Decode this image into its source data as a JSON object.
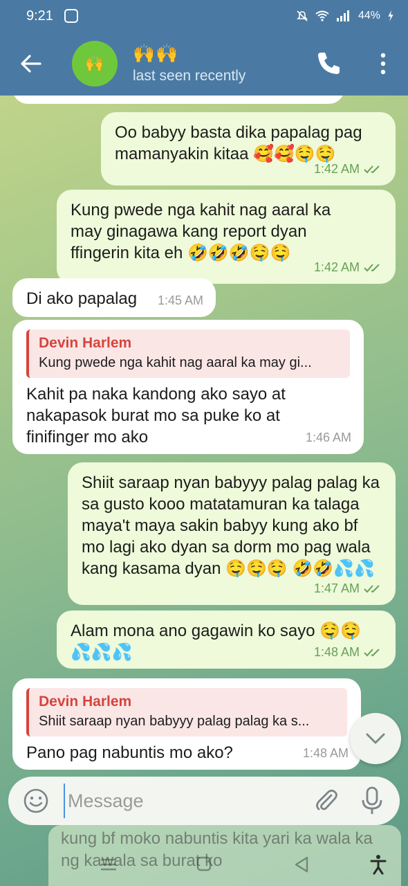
{
  "status": {
    "time": "9:21",
    "battery": "44%"
  },
  "header": {
    "title": "🙌🙌",
    "subtitle": "last seen recently",
    "avatar_glyph": "🙌"
  },
  "messages": [
    {
      "dir": "out",
      "text": "Oo babyy basta dika papalag pag mamanyakin kitaa 🥰🥰🤤🤤",
      "time": "1:42 AM",
      "read": true
    },
    {
      "dir": "out",
      "text": "Kung pwede nga kahit nag aaral ka may ginagawa kang report dyan ffingerin kita eh 🤣🤣🤣🤤🤤",
      "time": "1:42 AM",
      "read": true
    },
    {
      "dir": "in",
      "text": "Di ako papalag",
      "time": "1:45 AM"
    },
    {
      "dir": "in",
      "reply_name": "Devin Harlem",
      "reply_text": "Kung pwede nga kahit nag aaral ka may gi...",
      "text": "Kahit pa naka kandong ako sayo at nakapasok burat mo sa puke ko at finifinger mo ako",
      "time": "1:46 AM"
    },
    {
      "dir": "out",
      "text": "Shiit saraap nyan babyyy palag palag ka sa gusto kooo matatamuran ka talaga maya't maya sakin babyy kung ako bf mo lagi ako dyan sa dorm mo pag wala kang kasama dyan 🤤🤤🤤 🤣🤣💦💦",
      "time": "1:47 AM",
      "read": true
    },
    {
      "dir": "out",
      "text": "Alam mona ano gagawin ko sayo 🤤🤤 💦💦💦",
      "time": "1:48 AM",
      "read": true
    },
    {
      "dir": "in",
      "reply_name": "Devin Harlem",
      "reply_text": "Shiit saraap nyan babyyy palag palag ka s...",
      "text": "Pano pag nabuntis mo ako?",
      "time": "1:48 AM"
    }
  ],
  "composer": {
    "placeholder": "Message"
  },
  "ghost_text": "kung bf moko nabuntis kita yari ka wala ka ng kawala sa burat ko"
}
